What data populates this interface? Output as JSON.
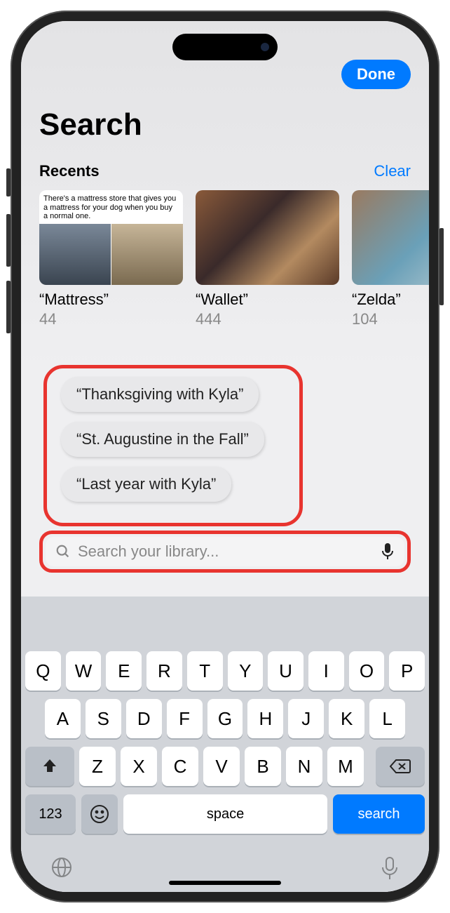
{
  "header": {
    "done_label": "Done",
    "title": "Search"
  },
  "recents": {
    "label": "Recents",
    "clear_label": "Clear",
    "items": [
      {
        "meme_text": "There's a mattress store that gives you a mattress for your dog when you buy a normal one.",
        "title": "“Mattress”",
        "count": "44"
      },
      {
        "title": "“Wallet”",
        "count": "444"
      },
      {
        "title": "“Zelda”",
        "count": "104"
      }
    ]
  },
  "suggestions": [
    "“Thanksgiving with Kyla”",
    "“St. Augustine in the Fall”",
    "“Last year with Kyla”"
  ],
  "search": {
    "placeholder": "Search your library..."
  },
  "keyboard": {
    "row1": [
      "Q",
      "W",
      "E",
      "R",
      "T",
      "Y",
      "U",
      "I",
      "O",
      "P"
    ],
    "row2": [
      "A",
      "S",
      "D",
      "F",
      "G",
      "H",
      "J",
      "K",
      "L"
    ],
    "row3": [
      "Z",
      "X",
      "C",
      "V",
      "B",
      "N",
      "M"
    ],
    "numbers_label": "123",
    "space_label": "space",
    "search_label": "search"
  }
}
